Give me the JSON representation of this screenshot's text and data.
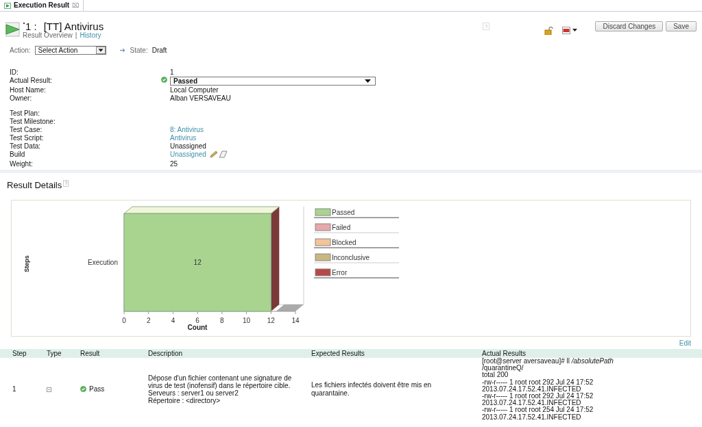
{
  "tab": {
    "title": "Execution Result",
    "close": "⌧"
  },
  "header": {
    "dirty": true,
    "number": "1 :",
    "title": "[TT] Antivirus",
    "links": [
      {
        "label": "Result Overview",
        "selected": true
      },
      {
        "label": "History",
        "selected": false
      }
    ],
    "separator": "|",
    "help": "?",
    "buttons": [
      "Discard Changes",
      "Save"
    ]
  },
  "action": {
    "label": "Action:",
    "value": "Select Action",
    "state_label": "State:",
    "state": "Draft"
  },
  "fields": [
    {
      "label": "ID:",
      "value": "1",
      "kind": "text"
    },
    {
      "label": "Actual Result:",
      "value": "Passed",
      "kind": "select"
    },
    {
      "label": "Host Name:",
      "value": "Local Computer",
      "kind": "text"
    },
    {
      "label": "Owner:",
      "value": "Alban VERSAVEAU",
      "kind": "text"
    },
    {
      "kind": "gap"
    },
    {
      "label": "Test Plan:",
      "kind": "text"
    },
    {
      "label": "Test Milestone:",
      "kind": "text"
    },
    {
      "label": "Test Case:",
      "value": "8:  Antivirus",
      "kind": "link"
    },
    {
      "label": "Test Script:",
      "value": "Antivirus",
      "kind": "link"
    },
    {
      "label": "Test Data:",
      "value": "Unassigned",
      "kind": "text"
    },
    {
      "label": "Build",
      "value": "Unassigned",
      "kind": "editlink"
    },
    {
      "label": "Weight:",
      "value": "25",
      "kind": "text"
    }
  ],
  "details": {
    "title": "Result Details",
    "help": "?",
    "edit": "Edit",
    "chart_data": {
      "type": "bar",
      "orientation": "horizontal",
      "xlabel": "Count",
      "categories": [
        "Execution"
      ],
      "series": [
        {
          "name": "Passed",
          "color": "#a8d490",
          "values": [
            12
          ],
          "value_labels": [
            "12"
          ]
        },
        {
          "name": "Failed",
          "color": "#e8a8ac",
          "values": [
            0
          ],
          "value_labels": [
            null
          ]
        },
        {
          "name": "Blocked",
          "color": "#f4c498",
          "values": [
            0
          ],
          "value_labels": [
            null
          ]
        },
        {
          "name": "Inconclusive",
          "color": "#c8b880",
          "values": [
            0
          ],
          "value_labels": [
            null
          ]
        },
        {
          "name": "Error",
          "color": "#b84848",
          "values": [
            0
          ],
          "value_labels": [
            null
          ]
        }
      ],
      "xlim": [
        0,
        14
      ],
      "xticks": [
        0,
        2,
        4,
        6,
        8,
        10,
        12,
        14
      ],
      "annotations": [
        {
          "text": "Steps"
        }
      ]
    }
  },
  "table": {
    "columns": [
      "Step",
      "Type",
      "Result",
      "Description",
      "Expected Results",
      "Actual Results"
    ],
    "rows": [
      {
        "step": "1",
        "result": "Pass",
        "passed": true,
        "description": [
          "Dépose d'un fichier contenant une signature de virus de test (inofensif) dans le répertoire cible.",
          "Serveurs : server1 ou server2",
          "Répertoire : <directory>"
        ],
        "expected": "Les fichiers infectés doivent être mis en quarantaine.",
        "actual": [
          "[root@server aversaveau]# ll */absolutePath*",
          "/quarantineQ/",
          "total 200",
          "-rw-r----- 1 root root   292 Jul 24 17:52",
          "2013.07.24.17.52.41.INFECTED",
          "-rw-r----- 1 root root   292 Jul 24 17:52",
          "2013.07.24.17.52.41.INFECTED",
          "-rw-r----- 1 root root   254 Jul 24 17:52",
          "2013.07.24.17.52.41.INFECTED"
        ]
      }
    ]
  }
}
